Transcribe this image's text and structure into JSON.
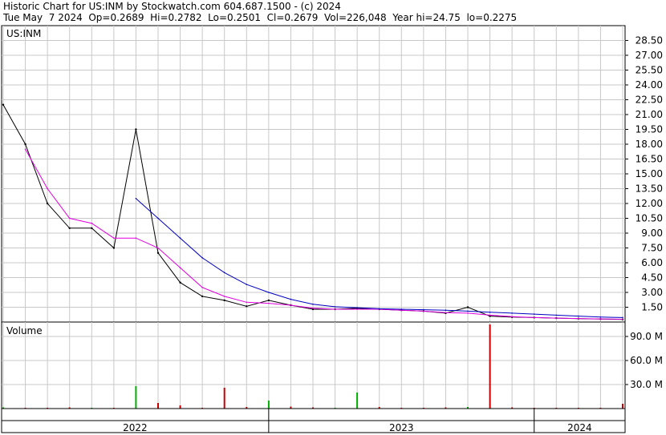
{
  "header": {
    "line1": "Historic Chart for US:INM by Stockwatch.com 604.687.1500 - (c) 2024",
    "line2": "Tue May  7 2024  Op=0.2689  Hi=0.2782  Lo=0.2501  Cl=0.2679  Vol=226,048  Year hi=24.75  lo=0.2275"
  },
  "colors": {
    "price": "#000000",
    "ma_short": "#e000e0",
    "ma_long": "#0000c0",
    "recent_price": "#cc0000",
    "volume_up": "#00b000",
    "volume_down": "#cc0000",
    "grid": "#c8c8c8"
  },
  "chart_data": [
    {
      "type": "line",
      "title": "US:INM",
      "ylim": [
        0,
        30
      ],
      "yticks": [
        "28.50",
        "27.00",
        "25.50",
        "24.00",
        "22.50",
        "21.00",
        "19.50",
        "18.00",
        "16.50",
        "15.00",
        "13.50",
        "12.00",
        "10.50",
        "9.00",
        "7.50",
        "6.00",
        "4.50",
        "3.00",
        "1.50"
      ],
      "x": [
        "2022-01",
        "2022-02",
        "2022-03",
        "2022-04",
        "2022-05",
        "2022-06",
        "2022-07",
        "2022-08",
        "2022-09",
        "2022-10",
        "2022-11",
        "2022-12",
        "2023-01",
        "2023-02",
        "2023-03",
        "2023-04",
        "2023-05",
        "2023-06",
        "2023-07",
        "2023-08",
        "2023-09",
        "2023-10",
        "2023-11",
        "2023-12",
        "2024-01",
        "2024-02",
        "2024-03",
        "2024-04",
        "2024-05"
      ],
      "series": [
        {
          "values": [
            22.0,
            18.0,
            12.0,
            9.5,
            9.5,
            7.5,
            19.5,
            7.0,
            4.0,
            2.6,
            2.2,
            1.6,
            2.2,
            1.7,
            1.3,
            1.3,
            1.4,
            1.3,
            1.2,
            1.1,
            0.9,
            1.5,
            0.6,
            0.5,
            0.45,
            0.4,
            0.35,
            0.3,
            0.27
          ]
        },
        {
          "values": [
            null,
            17.5,
            13.5,
            10.5,
            10.0,
            8.5,
            8.5,
            7.5,
            5.5,
            3.5,
            2.6,
            2.0,
            1.9,
            1.7,
            1.4,
            1.3,
            1.3,
            1.3,
            1.2,
            1.1,
            0.95,
            0.9,
            0.7,
            0.55,
            0.45,
            0.4,
            0.36,
            0.32,
            0.28
          ]
        },
        {
          "values": [
            null,
            null,
            null,
            null,
            null,
            null,
            12.5,
            10.5,
            8.5,
            6.5,
            5.0,
            3.8,
            3.0,
            2.3,
            1.8,
            1.55,
            1.45,
            1.35,
            1.3,
            1.25,
            1.2,
            1.1,
            1.0,
            0.9,
            0.8,
            0.7,
            0.6,
            0.5,
            0.45
          ]
        }
      ]
    },
    {
      "type": "bar",
      "title": "Volume",
      "ylim": [
        0,
        108
      ],
      "yticks": [
        "90.0 M",
        "60.0 M",
        "30.0 M"
      ],
      "categories": [
        "2022-01",
        "2022-02",
        "2022-03",
        "2022-04",
        "2022-05",
        "2022-06",
        "2022-07",
        "2022-08",
        "2022-09",
        "2022-10",
        "2022-11",
        "2022-12",
        "2023-01",
        "2023-02",
        "2023-03",
        "2023-04",
        "2023-05",
        "2023-06",
        "2023-07",
        "2023-08",
        "2023-09",
        "2023-10",
        "2023-11",
        "2023-12",
        "2024-01",
        "2024-02",
        "2024-03",
        "2024-04",
        "2024-05"
      ],
      "values": [
        1.5,
        1.0,
        1.0,
        1.5,
        1.0,
        1.0,
        28.0,
        7.0,
        4.0,
        1.0,
        26.0,
        2.0,
        10.0,
        2.5,
        1.5,
        1.0,
        20.0,
        2.0,
        1.0,
        1.0,
        1.5,
        2.0,
        105.0,
        1.5,
        1.0,
        1.0,
        1.0,
        1.0,
        6.0
      ]
    }
  ],
  "time_axis": [
    "2022",
    "2023",
    "2024"
  ]
}
